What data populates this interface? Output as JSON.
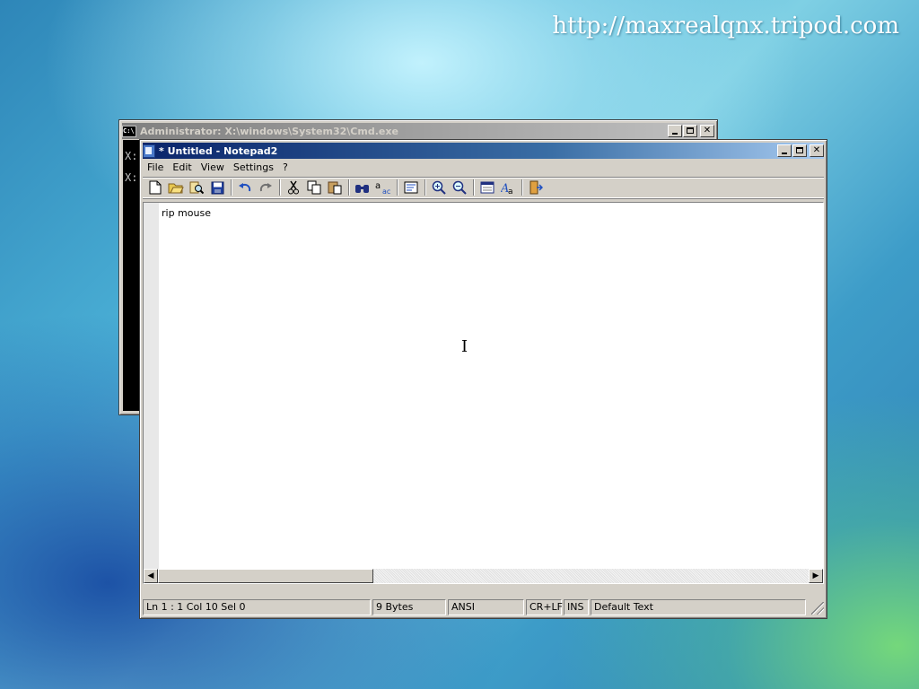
{
  "watermark": "http://maxrealqnx.tripod.com",
  "cmd_window": {
    "title": "Administrator: X:\\windows\\System32\\Cmd.exe",
    "icon_text": "C:\\",
    "lines": [
      "X:",
      "X:"
    ]
  },
  "notepad": {
    "title": "* Untitled - Notepad2",
    "menu": [
      "File",
      "Edit",
      "View",
      "Settings",
      "?"
    ],
    "toolbar_icons": [
      "new-file-icon",
      "open-file-icon",
      "browse-icon",
      "save-icon",
      "undo-icon",
      "redo-icon",
      "cut-icon",
      "copy-icon",
      "paste-icon",
      "find-icon",
      "replace-icon",
      "word-wrap-icon",
      "zoom-in-icon",
      "zoom-out-icon",
      "scheme-icon",
      "font-icon",
      "exit-icon"
    ],
    "content": "rip mouse",
    "status": {
      "position": "Ln 1 : 1   Col 10   Sel 0",
      "size": "9 Bytes",
      "encoding": "ANSI",
      "line_endings": "CR+LF",
      "mode": "INS",
      "scheme": "Default Text"
    }
  }
}
